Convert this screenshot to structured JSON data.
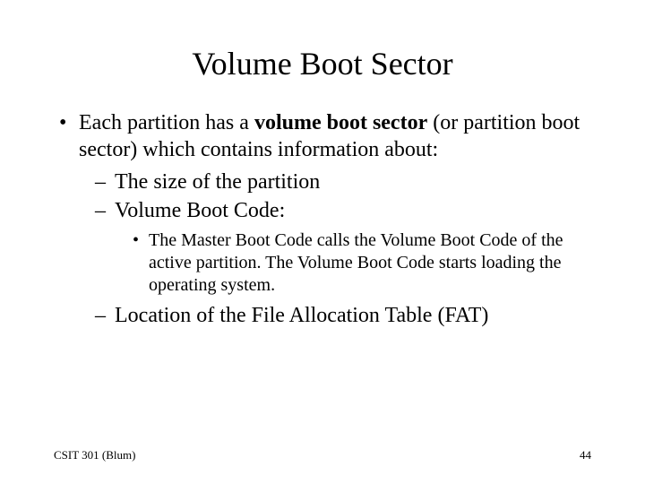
{
  "title": "Volume Boot Sector",
  "bullet1_pre": "Each partition has a ",
  "bullet1_bold": "volume boot sector",
  "bullet1_post": " (or partition boot sector) which contains information about:",
  "sub1": "The size of the partition",
  "sub2": "Volume Boot Code:",
  "subsub": "The Master Boot Code calls the Volume Boot Code of the active partition. The Volume Boot Code starts loading the operating system.",
  "sub3": "Location of the File Allocation Table (FAT)",
  "footer_left": "CSIT 301 (Blum)",
  "footer_right": "44"
}
